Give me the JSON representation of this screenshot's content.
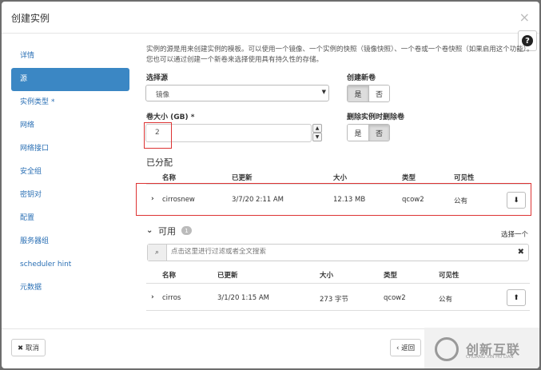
{
  "dialog": {
    "title": "创建实例",
    "close_glyph": "×",
    "help_glyph": "?"
  },
  "sidebar": {
    "items": [
      {
        "label": "详情",
        "active": false
      },
      {
        "label": "源",
        "active": true
      },
      {
        "label": "实例类型",
        "active": false,
        "required": "*"
      },
      {
        "label": "网络",
        "active": false
      },
      {
        "label": "网络接口",
        "active": false
      },
      {
        "label": "安全组",
        "active": false
      },
      {
        "label": "密钥对",
        "active": false
      },
      {
        "label": "配置",
        "active": false
      },
      {
        "label": "服务器组",
        "active": false
      },
      {
        "label": "scheduler hint",
        "active": false
      },
      {
        "label": "元数据",
        "active": false
      }
    ]
  },
  "source": {
    "description": "实例的源是用来创建实例的模板。可以使用一个镜像、一个实例的快照（镜像快照）、一个卷或一个卷快照（如果启用这个功能）。您也可以通过创建一个新卷来选择使用具有持久性的存储。",
    "select_source_label": "选择源",
    "select_source_value": "镜像",
    "create_new_volume_label": "创建新卷",
    "volume_size_label": "卷大小 (GB)",
    "volume_size_required": "*",
    "volume_size_value": "2",
    "delete_on_terminate_label": "删除实例时删除卷",
    "yes": "是",
    "no": "否",
    "create_new_volume_selected": "是",
    "delete_on_terminate_selected": "否"
  },
  "allocated": {
    "title": "已分配",
    "headers": [
      "名称",
      "已更新",
      "大小",
      "类型",
      "可见性"
    ],
    "rows": [
      {
        "name": "cirrosnew",
        "updated": "3/7/20 2:11 AM",
        "size": "12.13 MB",
        "type": "qcow2",
        "visibility": "公有"
      }
    ]
  },
  "available": {
    "title": "可用",
    "count": "1",
    "choose_one": "选择一个",
    "search_placeholder": "点击这里进行过滤或者全文搜索",
    "headers": [
      "名称",
      "已更新",
      "大小",
      "类型",
      "可见性"
    ],
    "rows": [
      {
        "name": "cirros",
        "updated": "3/1/20 1:15 AM",
        "size": "273 字节",
        "type": "qcow2",
        "visibility": "公有"
      }
    ]
  },
  "footer": {
    "cancel_label": "✖ 取消",
    "back_label": "‹ 返回"
  },
  "watermark": {
    "text_cn": "创新互联",
    "text_en": "CHUANG XIN HU LIAN"
  },
  "colors": {
    "accent": "#3b87c4",
    "link": "#2a6fb4",
    "highlight_box": "#dd3333"
  }
}
